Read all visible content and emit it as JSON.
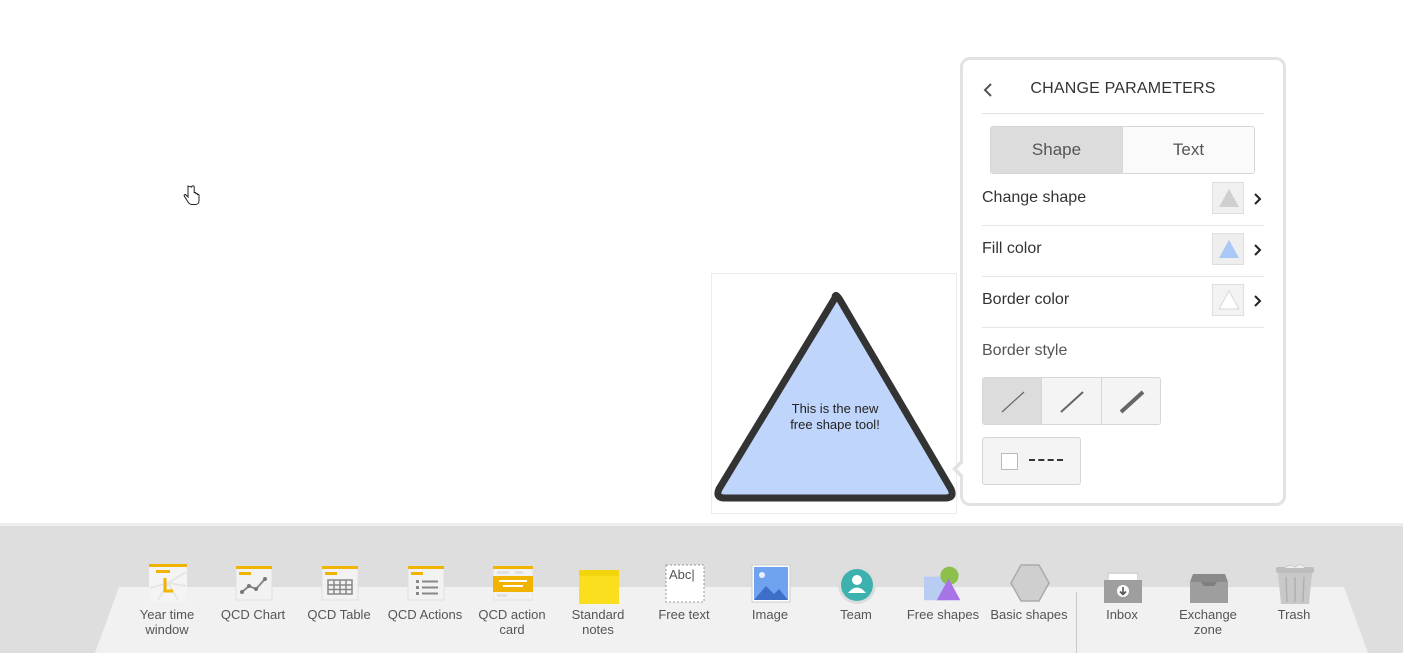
{
  "canvas": {
    "shape_text": "This is the new free shape tool!",
    "shape_fill": "#c0d5fb",
    "shape_border": "#333333"
  },
  "panel": {
    "title": "CHANGE PARAMETERS",
    "tabs": [
      {
        "label": "Shape",
        "active": true
      },
      {
        "label": "Text",
        "active": false
      }
    ],
    "properties": [
      {
        "label": "Change shape",
        "swatch_color": "#cfcfcf"
      },
      {
        "label": "Fill color",
        "swatch_color": "#a9c8f7"
      },
      {
        "label": "Border color",
        "swatch_color": "#ffffff"
      }
    ],
    "border_style_label": "Border style",
    "border_widths": [
      "thin",
      "medium",
      "thick"
    ],
    "active_border_width": "thin",
    "dashed_enabled": false
  },
  "toolbar": {
    "items": [
      {
        "label": "Year time window",
        "icon": "year-time-window-icon"
      },
      {
        "label": "QCD Chart",
        "icon": "qcd-chart-icon"
      },
      {
        "label": "QCD Table",
        "icon": "qcd-table-icon"
      },
      {
        "label": "QCD Actions",
        "icon": "qcd-actions-icon"
      },
      {
        "label": "QCD action card",
        "icon": "qcd-action-card-icon"
      },
      {
        "label": "Standard notes",
        "icon": "standard-notes-icon"
      },
      {
        "label": "Free text",
        "icon": "free-text-icon",
        "icon_text": "Abc|"
      },
      {
        "label": "Image",
        "icon": "image-icon"
      },
      {
        "label": "Team",
        "icon": "team-icon"
      },
      {
        "label": "Free shapes",
        "icon": "free-shapes-icon"
      },
      {
        "label": "Basic shapes",
        "icon": "basic-shapes-icon"
      },
      {
        "label": "Inbox",
        "icon": "inbox-icon"
      },
      {
        "label": "Exchange zone",
        "icon": "exchange-zone-icon"
      },
      {
        "label": "Trash",
        "icon": "trash-icon"
      }
    ]
  },
  "colors": {
    "accent_yellow": "#f0b400",
    "note_yellow": "#f9df1e",
    "team_teal": "#3db1ae",
    "free_shape_purple": "#a774e8",
    "free_shape_green": "#8cc04b"
  }
}
